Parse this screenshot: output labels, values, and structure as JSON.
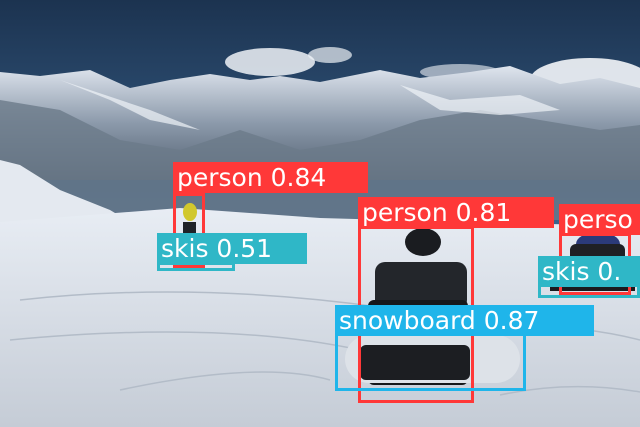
{
  "detections": [
    {
      "label": "person 0.84",
      "class": "person",
      "color": "#ff3838"
    },
    {
      "label": "skis 0.51",
      "class": "skis",
      "color": "#2fb7c7"
    },
    {
      "label": "person 0.81",
      "class": "person",
      "color": "#ff3838"
    },
    {
      "label": "snowboard 0.87",
      "class": "snowboard",
      "color": "#1fb5ea"
    },
    {
      "label": "perso",
      "class": "person",
      "color": "#ff3838"
    },
    {
      "label": "skis 0.",
      "class": "skis",
      "color": "#2fb7c7"
    }
  ]
}
